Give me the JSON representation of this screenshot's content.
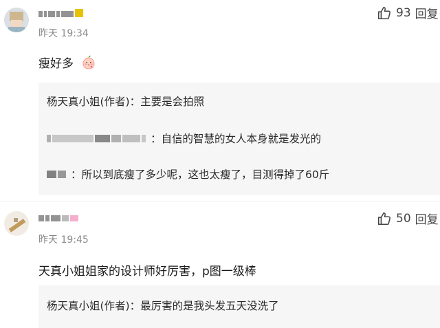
{
  "comments": [
    {
      "time": "昨天 19:34",
      "likes": "93",
      "reply_label": "回复",
      "text": "瘦好多",
      "emoji": "peach-face-emoji",
      "replies": [
        {
          "author": "杨天真小姐(作者)",
          "sep": "：",
          "text": "主要是会拍照"
        },
        {
          "author": "",
          "sep": "：",
          "text": "自信的智慧的女人本身就是发光的"
        },
        {
          "author": "",
          "sep": "：",
          "text": "所以到底瘦了多少呢，这也太瘦了，目测得掉了60斤"
        }
      ]
    },
    {
      "time": "昨天 19:45",
      "likes": "50",
      "reply_label": "回复",
      "text": "天真小姐姐家的设计师好厉害，p图一级棒",
      "replies": [
        {
          "author": "杨天真小姐(作者)",
          "sep": "：",
          "text": "最厉害的是我头发五天没洗了"
        }
      ]
    }
  ],
  "icons": {
    "like": "thumbs-up-icon"
  },
  "colors": {
    "reply_bg": "#f6f6f6",
    "time": "#8a8a8a",
    "text": "#1a1a1a"
  }
}
